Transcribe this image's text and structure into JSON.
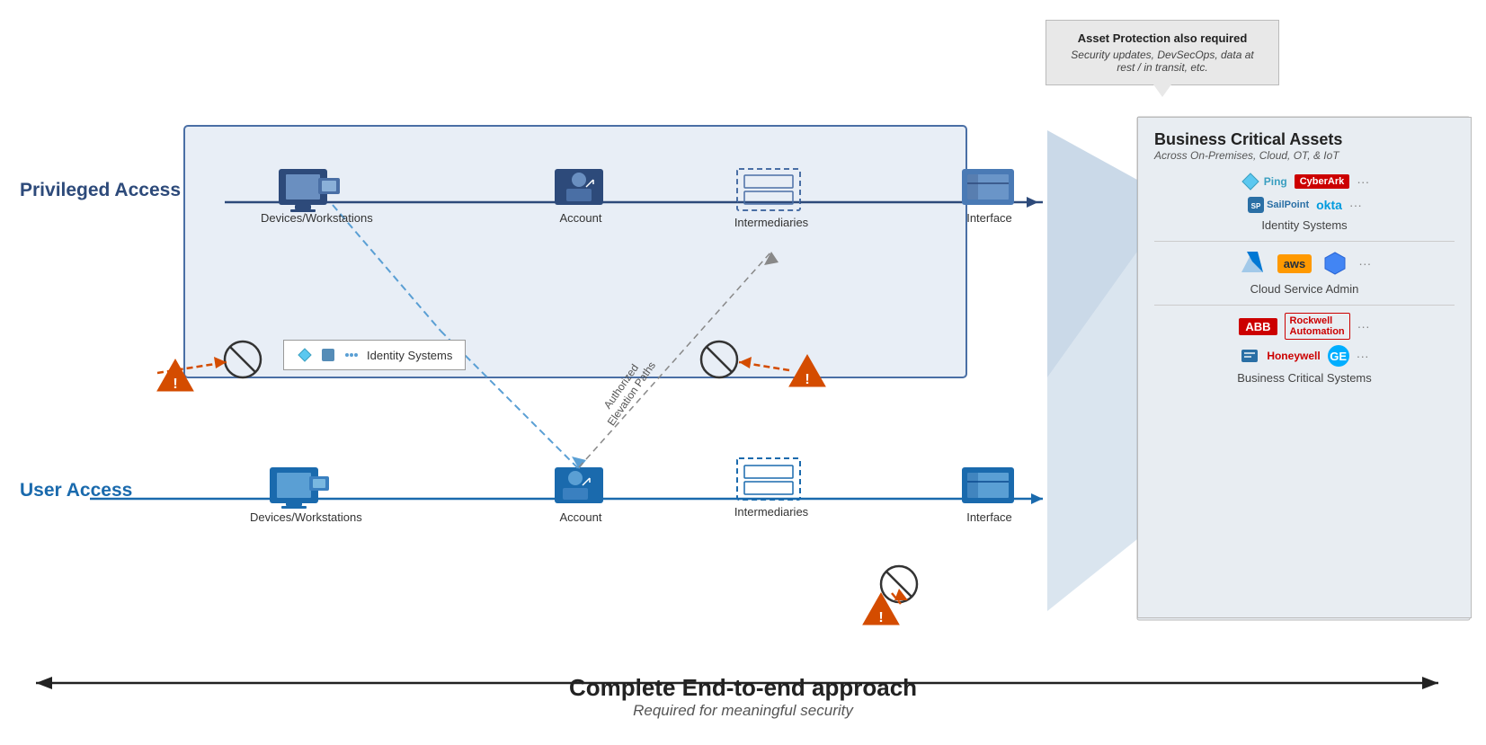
{
  "callout": {
    "title": "Asset Protection also required",
    "subtitle": "Security updates, DevSecOps, data at rest / in transit, etc."
  },
  "labels": {
    "privileged_access": "Privileged Access",
    "user_access": "User Access",
    "bottom_title": "Complete End-to-end approach",
    "bottom_subtitle": "Required for meaningful security"
  },
  "bca": {
    "title": "Business Critical Assets",
    "subtitle": "Across On-Premises, Cloud, OT, & IoT",
    "sections": [
      {
        "name": "Identity Systems",
        "logos": [
          "Ping",
          "CyberArk",
          "SailPoint",
          "okta",
          "..."
        ]
      },
      {
        "name": "Cloud Service Admin",
        "logos": [
          "Azure",
          "aws",
          "GCP",
          "..."
        ]
      },
      {
        "name": "Business Critical Systems",
        "logos": [
          "ABB",
          "Rockwell Automation",
          "Honeywell",
          "GE",
          "..."
        ]
      }
    ]
  },
  "privileged_row": {
    "nodes": [
      "Devices/Workstations",
      "Account",
      "Intermediaries",
      "Interface"
    ]
  },
  "user_row": {
    "nodes": [
      "Devices/Workstations",
      "Account",
      "Interface"
    ]
  },
  "intermediaries": {
    "upper": "Intermediaries",
    "lower": "Intermediaries"
  },
  "identity_popup": "Identity Systems",
  "elevation_label": "Authorized\nElevation Paths"
}
